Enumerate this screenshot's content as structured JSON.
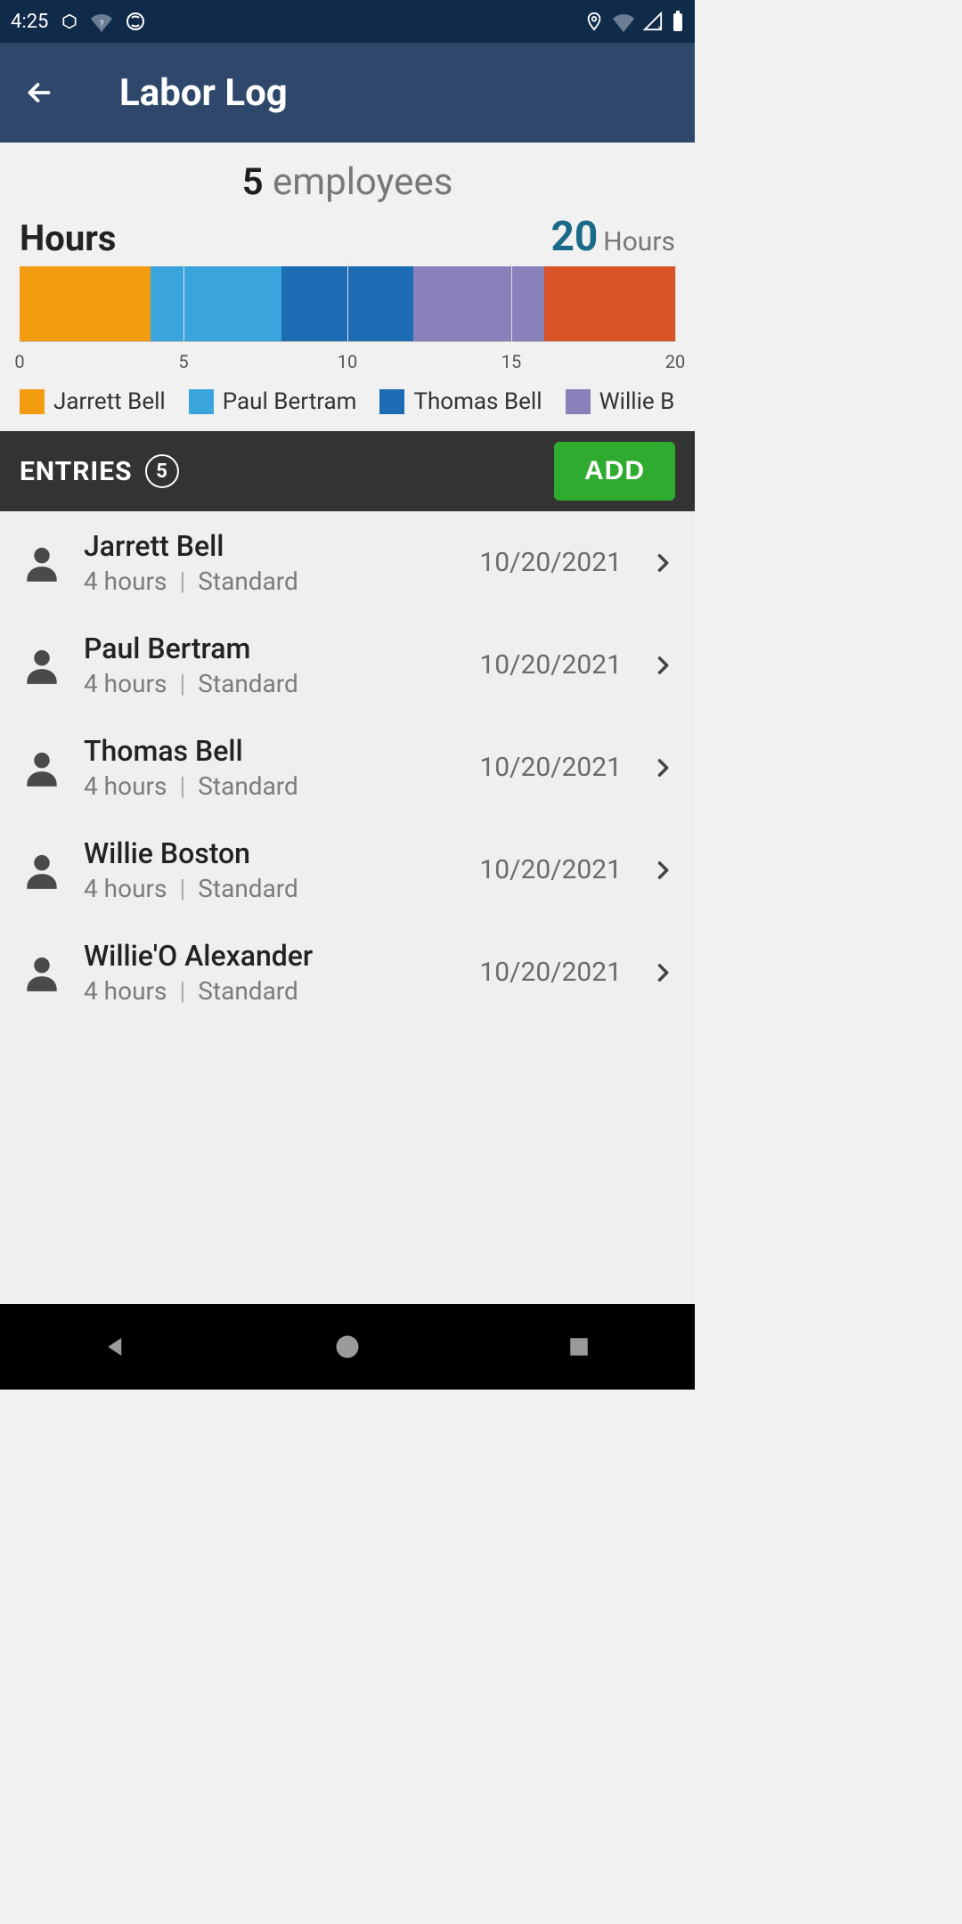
{
  "status": {
    "time": "4:25"
  },
  "appbar": {
    "title": "Labor Log"
  },
  "summary": {
    "employee_count": "5",
    "employee_word": "employees",
    "hours_label": "Hours",
    "hours_total": "20",
    "hours_unit": "Hours"
  },
  "chart_data": {
    "type": "bar",
    "title": "Hours",
    "xlabel": "",
    "ylabel": "",
    "xlim": [
      0,
      20
    ],
    "categories": [
      "Jarrett Bell",
      "Paul Bertram",
      "Thomas Bell",
      "Willie Boston",
      "Willie'O Alexander"
    ],
    "values": [
      4,
      4,
      4,
      4,
      4
    ],
    "ticks": [
      0,
      5,
      10,
      15,
      20
    ],
    "colors": [
      "#f39c12",
      "#3aa5dc",
      "#1c6db3",
      "#8981b9",
      "#d85427"
    ]
  },
  "legend": [
    {
      "label": "Jarrett Bell",
      "color": "#f39c12"
    },
    {
      "label": "Paul Bertram",
      "color": "#3aa5dc"
    },
    {
      "label": "Thomas Bell",
      "color": "#1c6db3"
    },
    {
      "label": "Willie Bosto",
      "color": "#8981b9"
    }
  ],
  "entries_header": {
    "label": "ENTRIES",
    "count": "5",
    "add": "ADD"
  },
  "entries": [
    {
      "name": "Jarrett Bell",
      "hours": "4 hours",
      "type": "Standard",
      "date": "10/20/2021"
    },
    {
      "name": "Paul Bertram",
      "hours": "4 hours",
      "type": "Standard",
      "date": "10/20/2021"
    },
    {
      "name": "Thomas Bell",
      "hours": "4 hours",
      "type": "Standard",
      "date": "10/20/2021"
    },
    {
      "name": "Willie Boston",
      "hours": "4 hours",
      "type": "Standard",
      "date": "10/20/2021"
    },
    {
      "name": "Willie'O Alexander",
      "hours": "4 hours",
      "type": "Standard",
      "date": "10/20/2021"
    }
  ]
}
